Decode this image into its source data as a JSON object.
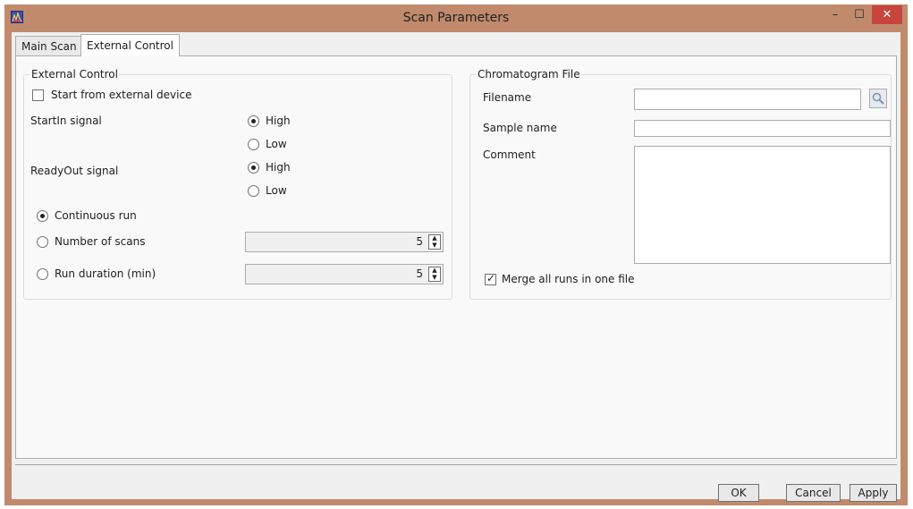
{
  "window": {
    "title": "Scan Parameters",
    "controls": {
      "minimize": "–",
      "maximize": "☐",
      "close": "✕"
    }
  },
  "tabs": [
    {
      "label": "Main Scan",
      "active": false
    },
    {
      "label": "External Control",
      "active": true
    }
  ],
  "external_control": {
    "group_title": "External Control",
    "start_from_external": {
      "label": "Start from external device",
      "checked": false
    },
    "startin_signal": {
      "label": "StartIn signal",
      "options": [
        {
          "label": "High",
          "selected": true
        },
        {
          "label": "Low",
          "selected": false
        }
      ]
    },
    "readyout_signal": {
      "label": "ReadyOut signal",
      "options": [
        {
          "label": "High",
          "selected": true
        },
        {
          "label": "Low",
          "selected": false
        }
      ]
    },
    "run_mode": [
      {
        "label": "Continuous run",
        "selected": true
      },
      {
        "label": "Number of scans",
        "selected": false,
        "value": "5"
      },
      {
        "label": "Run duration (min)",
        "selected": false,
        "value": "5"
      }
    ]
  },
  "chromatogram_file": {
    "group_title": "Chromatogram File",
    "filename": {
      "label": "Filename",
      "value": ""
    },
    "sample_name": {
      "label": "Sample name",
      "value": ""
    },
    "comment": {
      "label": "Comment",
      "value": ""
    },
    "merge_runs": {
      "label": "Merge all runs in one file",
      "checked": true
    }
  },
  "buttons": {
    "ok": "OK",
    "cancel": "Cancel",
    "apply": "Apply"
  },
  "colors": {
    "frame": "#c18a6c",
    "close_button": "#c7453d",
    "panel": "#f9f9f9"
  },
  "icons": {
    "app": "spectrum-app-icon",
    "browse": "magnifier-icon"
  }
}
